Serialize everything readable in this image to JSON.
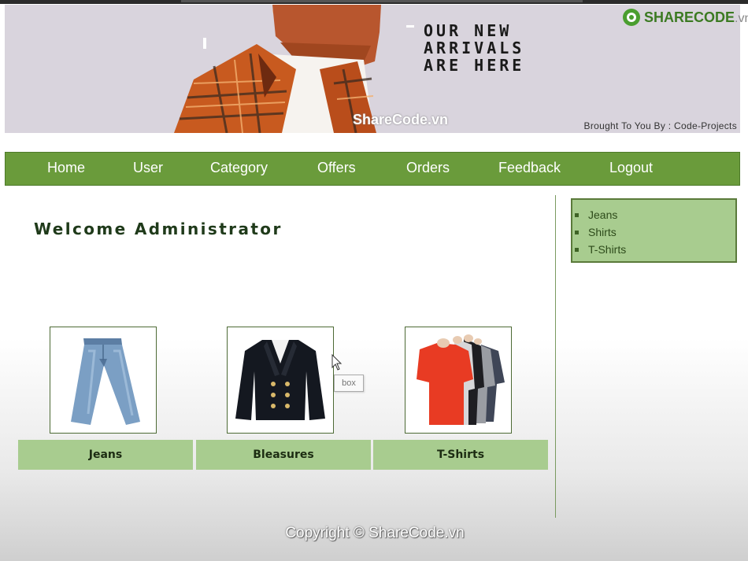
{
  "banner": {
    "title_lines": [
      "OUR NEW",
      "ARRIVALS",
      "ARE HERE"
    ],
    "credit": "Brought To You By : Code-Projects",
    "watermark": "ShareCode.vn"
  },
  "logo": {
    "brand": "SHARECODE",
    "suffix": ".vn"
  },
  "nav": {
    "items": [
      "Home",
      "User",
      "Category",
      "Offers",
      "Orders",
      "Feedback",
      "Logout"
    ]
  },
  "main": {
    "welcome": "Welcome Administrator",
    "products": [
      {
        "label": "Jeans",
        "icon": "jeans-image"
      },
      {
        "label": "Bleasures",
        "icon": "blazer-image"
      },
      {
        "label": "T-Shirts",
        "icon": "tshirts-image"
      }
    ]
  },
  "sidebar": {
    "items": [
      "Jeans",
      "Shirts",
      "T-Shirts"
    ]
  },
  "tooltip": "box",
  "footer": "Copyright © ShareCode.vn",
  "colors": {
    "nav_bg": "#6a9b3b",
    "panel_bg": "#a8cc8f",
    "banner_bg": "#d9d4dd"
  }
}
